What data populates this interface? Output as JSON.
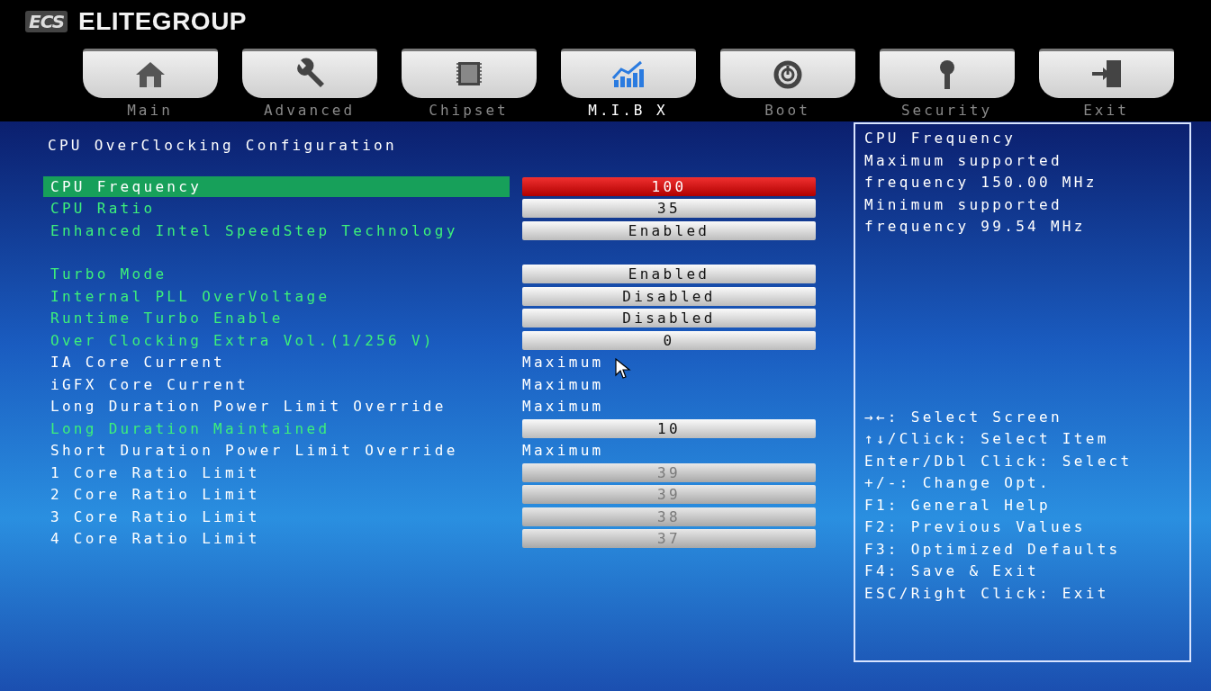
{
  "brand": {
    "logo": "ECS",
    "name": "ELITEGROUP"
  },
  "tabs": [
    {
      "label": "Main",
      "selected": false
    },
    {
      "label": "Advanced",
      "selected": false
    },
    {
      "label": "Chipset",
      "selected": false
    },
    {
      "label": "M.I.B X",
      "selected": true
    },
    {
      "label": "Boot",
      "selected": false
    },
    {
      "label": "Security",
      "selected": false
    },
    {
      "label": "Exit",
      "selected": false
    }
  ],
  "page_title": "CPU OverClocking Configuration",
  "setting_groups": [
    [
      {
        "label": "CPU Frequency",
        "value": "100",
        "kind": "field",
        "selected": true,
        "editable": true,
        "disabled": false
      },
      {
        "label": "CPU Ratio",
        "value": "35",
        "kind": "field",
        "selected": false,
        "editable": true,
        "disabled": false
      },
      {
        "label": "Enhanced Intel SpeedStep Technology",
        "value": "Enabled",
        "kind": "field",
        "selected": false,
        "editable": true,
        "disabled": false
      }
    ],
    [
      {
        "label": "Turbo Mode",
        "value": "Enabled",
        "kind": "field",
        "selected": false,
        "editable": true,
        "disabled": false
      },
      {
        "label": "Internal PLL OverVoltage",
        "value": "Disabled",
        "kind": "field",
        "selected": false,
        "editable": true,
        "disabled": false
      },
      {
        "label": "Runtime Turbo Enable",
        "value": "Disabled",
        "kind": "field",
        "selected": false,
        "editable": true,
        "disabled": false
      },
      {
        "label": "Over Clocking Extra Vol.(1/256 V)",
        "value": "0",
        "kind": "field",
        "selected": false,
        "editable": true,
        "disabled": false
      },
      {
        "label": "IA Core Current",
        "value": "Maximum",
        "kind": "text",
        "selected": false,
        "editable": false
      },
      {
        "label": "iGFX Core Current",
        "value": "Maximum",
        "kind": "text",
        "selected": false,
        "editable": false
      },
      {
        "label": "Long Duration Power Limit Override",
        "value": "Maximum",
        "kind": "text",
        "selected": false,
        "editable": false
      },
      {
        "label": "Long Duration Maintained",
        "value": "10",
        "kind": "field",
        "selected": false,
        "editable": true,
        "disabled": false
      },
      {
        "label": "Short Duration Power Limit Override",
        "value": "Maximum",
        "kind": "text",
        "selected": false,
        "editable": false
      },
      {
        "label": "1 Core Ratio Limit",
        "value": "39",
        "kind": "field",
        "selected": false,
        "editable": false,
        "disabled": true
      },
      {
        "label": "2 Core Ratio Limit",
        "value": "39",
        "kind": "field",
        "selected": false,
        "editable": false,
        "disabled": true
      },
      {
        "label": "3 Core Ratio Limit",
        "value": "38",
        "kind": "field",
        "selected": false,
        "editable": false,
        "disabled": true
      },
      {
        "label": "4 Core Ratio Limit",
        "value": "37",
        "kind": "field",
        "selected": false,
        "editable": false,
        "disabled": true
      }
    ]
  ],
  "help": {
    "title": "CPU Frequency",
    "lines": [
      "Maximum supported",
      "frequency 150.00 MHz",
      "Minimum supported",
      "frequency 99.54 MHz"
    ]
  },
  "key_hints": [
    "→←: Select Screen",
    "↑↓/Click: Select Item",
    "Enter/Dbl Click: Select",
    "+/-: Change Opt.",
    "F1: General Help",
    "F2: Previous Values",
    "F3: Optimized Defaults",
    "F4: Save & Exit",
    "ESC/Right Click: Exit"
  ]
}
